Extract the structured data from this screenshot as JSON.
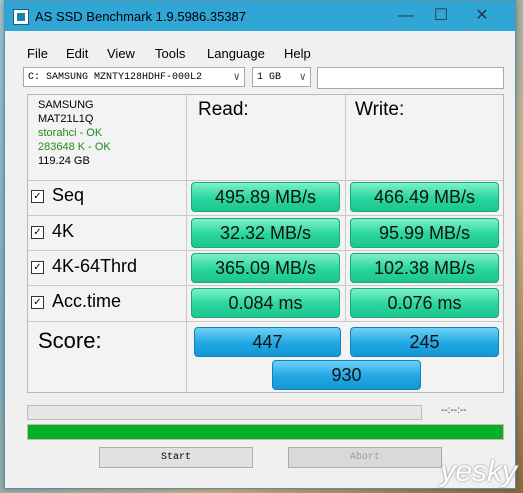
{
  "window": {
    "title": "AS SSD Benchmark 1.9.5986.35387"
  },
  "titlebar_buttons": {
    "minimize": "—",
    "maximize": "☐",
    "close": "✕"
  },
  "menu": [
    "File",
    "Edit",
    "View",
    "Tools",
    "Language",
    "Help"
  ],
  "drive_select": {
    "value": "C: SAMSUNG MZNTY128HDHF-000L2"
  },
  "size_select": {
    "value": "1 GB"
  },
  "drive_info": {
    "vendor": "SAMSUNG",
    "firmware": "MAT21L1Q",
    "driver": "storahci - OK",
    "alignment": "283648 K - OK",
    "capacity": "119.24 GB"
  },
  "headers": {
    "read": "Read:",
    "write": "Write:"
  },
  "tests": [
    {
      "label": "Seq",
      "checked": true,
      "read": "495.89 MB/s",
      "write": "466.49 MB/s"
    },
    {
      "label": "4K",
      "checked": true,
      "read": "32.32 MB/s",
      "write": "95.99 MB/s"
    },
    {
      "label": "4K-64Thrd",
      "checked": true,
      "read": "365.09 MB/s",
      "write": "102.38 MB/s"
    },
    {
      "label": "Acc.time",
      "checked": true,
      "read": "0.084 ms",
      "write": "0.076 ms"
    }
  ],
  "score": {
    "label": "Score:",
    "read": "447",
    "write": "245",
    "total": "930"
  },
  "progress": {
    "time": "--:--:--",
    "completed_fraction": 1.0
  },
  "buttons": {
    "start": "Start",
    "abort": "Abort"
  },
  "watermark": "yesky"
}
